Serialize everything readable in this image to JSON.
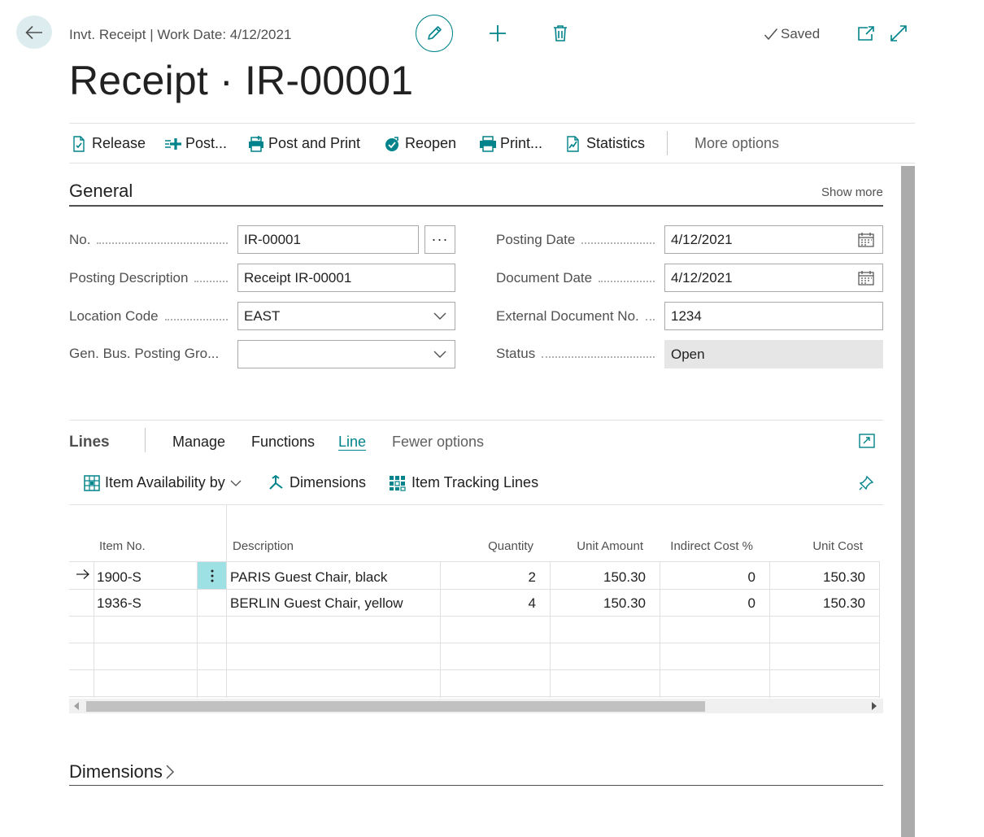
{
  "header": {
    "breadcrumb": "Invt. Receipt | Work Date: 4/12/2021",
    "saved_label": "Saved",
    "title": "Receipt · IR-00001"
  },
  "actions": {
    "release": "Release",
    "post": "Post...",
    "post_and_print": "Post and Print",
    "reopen": "Reopen",
    "print": "Print...",
    "statistics": "Statistics",
    "more_options": "More options"
  },
  "general": {
    "title": "General",
    "show_more": "Show more",
    "fields": {
      "no": {
        "label": "No.",
        "value": "IR-00001"
      },
      "posting_description": {
        "label": "Posting Description",
        "value": "Receipt IR-00001"
      },
      "location_code": {
        "label": "Location Code",
        "value": "EAST"
      },
      "gen_bus_posting_group": {
        "label": "Gen. Bus. Posting Gro...",
        "value": ""
      },
      "posting_date": {
        "label": "Posting Date",
        "value": "4/12/2021"
      },
      "document_date": {
        "label": "Document Date",
        "value": "4/12/2021"
      },
      "external_document_no": {
        "label": "External Document No.",
        "value": "1234"
      },
      "status": {
        "label": "Status",
        "value": "Open"
      }
    }
  },
  "lines": {
    "title": "Lines",
    "tabs": [
      "Manage",
      "Functions",
      "Line",
      "Fewer options"
    ],
    "active_tab": "Line",
    "subactions": {
      "item_availability": "Item Availability by",
      "dimensions": "Dimensions",
      "item_tracking": "Item Tracking Lines"
    },
    "columns": {
      "item_no": "Item No.",
      "description": "Description",
      "quantity": "Quantity",
      "unit_amount": "Unit Amount",
      "indirect_cost": "Indirect Cost %",
      "unit_cost": "Unit Cost"
    },
    "rows": [
      {
        "item_no": "1900-S",
        "description": "PARIS Guest Chair, black",
        "quantity": "2",
        "unit_amount": "150.30",
        "indirect_cost": "0",
        "unit_cost": "150.30"
      },
      {
        "item_no": "1936-S",
        "description": "BERLIN Guest Chair, yellow",
        "quantity": "4",
        "unit_amount": "150.30",
        "indirect_cost": "0",
        "unit_cost": "150.30"
      }
    ]
  },
  "dimensions": {
    "title": "Dimensions"
  },
  "colors": {
    "accent": "#00838a",
    "back_button_bg": "#dcecef",
    "readonly_field_bg": "#e6e6e6",
    "selected_cell_bg": "#9ee1e5"
  },
  "icons": {
    "back": "arrow-left-icon",
    "edit": "pencil-icon",
    "new": "plus-icon",
    "delete": "trash-icon",
    "saved": "checkmark-icon",
    "open_new_window": "open-in-new-icon",
    "collapse": "expand-arrows-icon",
    "calendar": "calendar-icon",
    "dropdown": "chevron-down-icon"
  }
}
